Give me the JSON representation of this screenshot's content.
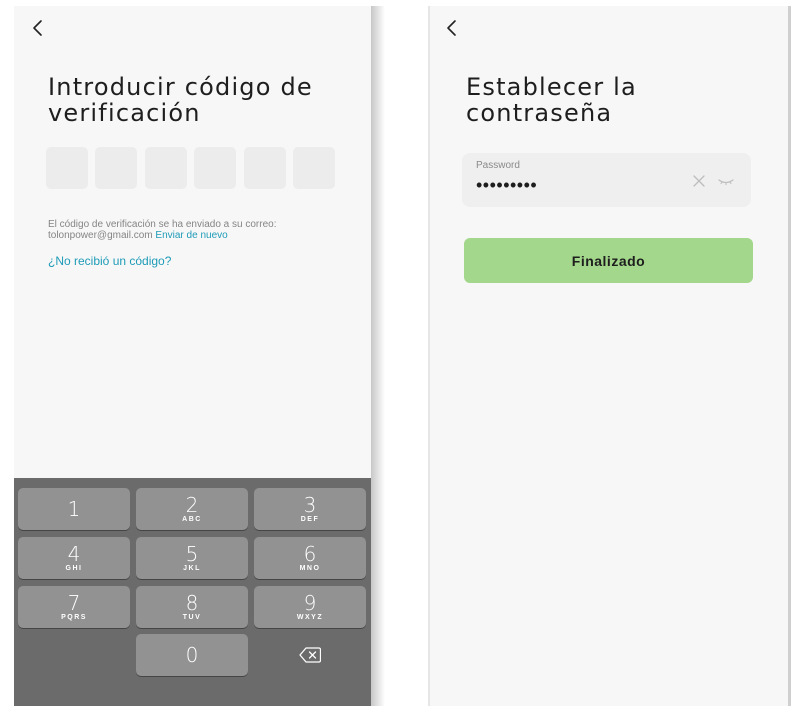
{
  "verification_screen": {
    "title_line1": "Introducir código de",
    "title_line2": "verificación",
    "code_box_count": 6,
    "info_line1": "El código de verificación se ha enviado a su correo:",
    "email": "tolonpower@gmail.com",
    "resend_link": "Enviar de nuevo",
    "no_code_link": "¿No recibió un código?",
    "back_icon": "chevron-left-icon"
  },
  "keyboard": {
    "keys": [
      {
        "num": "1",
        "letters": ""
      },
      {
        "num": "2",
        "letters": "ABC"
      },
      {
        "num": "3",
        "letters": "DEF"
      },
      {
        "num": "4",
        "letters": "GHI"
      },
      {
        "num": "5",
        "letters": "JKL"
      },
      {
        "num": "6",
        "letters": "MNO"
      },
      {
        "num": "7",
        "letters": "PQRS"
      },
      {
        "num": "8",
        "letters": "TUV"
      },
      {
        "num": "9",
        "letters": "WXYZ"
      },
      {
        "num": "0",
        "letters": ""
      }
    ],
    "delete_icon": "backspace-icon",
    "colors": {
      "background": "#6b6b6b",
      "key": "#929292"
    }
  },
  "password_screen": {
    "title_line1": "Establecer la",
    "title_line2": "contraseña",
    "password_label": "Password",
    "password_value": "•••••••••",
    "clear_icon": "close-icon",
    "visibility_icon": "eye-closed-icon",
    "submit_label": "Finalizado",
    "back_icon": "chevron-left-icon"
  },
  "colors": {
    "link": "#1e9bb7",
    "button": "#a3d78b",
    "screen_background": "#f7f7f7"
  }
}
